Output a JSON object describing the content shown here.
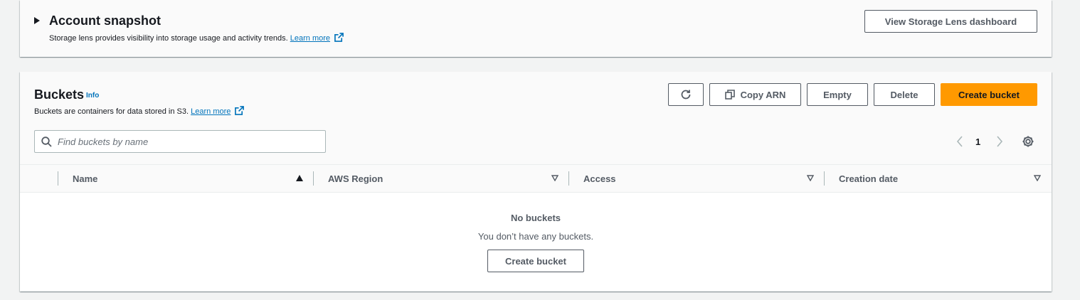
{
  "snapshot": {
    "title": "Account snapshot",
    "description": "Storage lens provides visibility into storage usage and activity trends.",
    "learn_more": "Learn more",
    "dashboard_button": "View Storage Lens dashboard"
  },
  "buckets": {
    "title": "Buckets",
    "info": "Info",
    "description": "Buckets are containers for data stored in S3.",
    "learn_more": "Learn more",
    "buttons": {
      "copy_arn": "Copy ARN",
      "empty": "Empty",
      "delete": "Delete",
      "create": "Create bucket"
    },
    "search": {
      "placeholder": "Find buckets by name",
      "value": ""
    },
    "pagination": {
      "page": "1"
    },
    "columns": {
      "name": "Name",
      "region": "AWS Region",
      "access": "Access",
      "creation_date": "Creation date"
    },
    "empty_state": {
      "title": "No buckets",
      "message": "You don’t have any buckets.",
      "button": "Create bucket"
    }
  },
  "colors": {
    "primary": "#ff9900",
    "link": "#0073bb",
    "text": "#16191f",
    "muted": "#545b64"
  },
  "icons": [
    "caret-right-icon",
    "external-link-icon",
    "refresh-icon",
    "copy-icon",
    "search-icon",
    "chevron-left-icon",
    "chevron-right-icon",
    "settings-gear-icon",
    "sort-ascending-icon",
    "sort-descending-icon"
  ]
}
